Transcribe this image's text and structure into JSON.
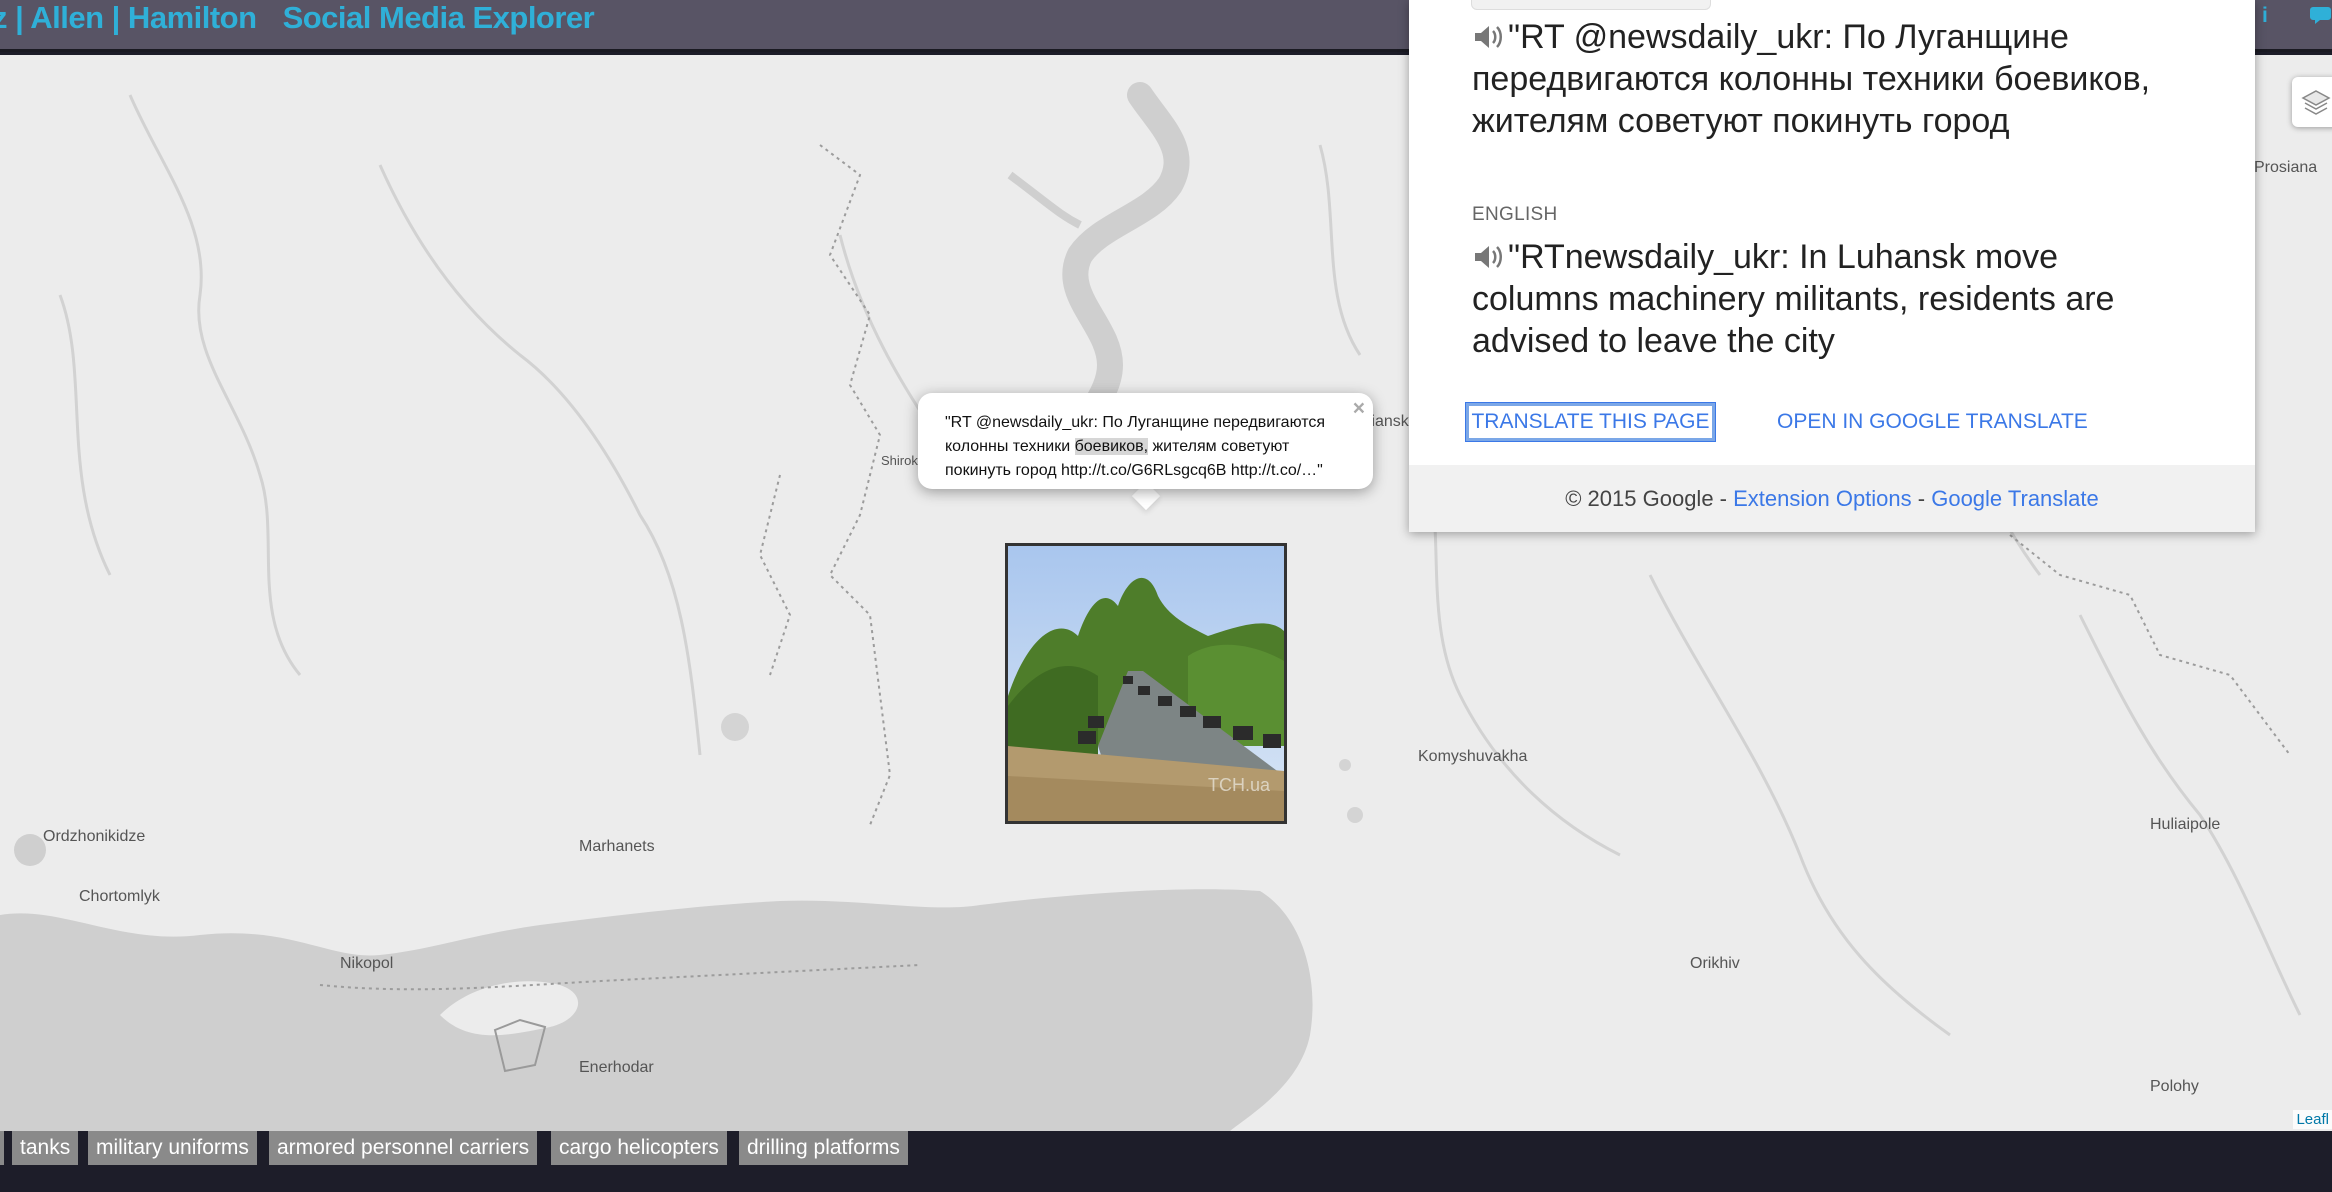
{
  "header": {
    "brand_fragment": "z | Allen | Hamilton",
    "app_title": "Social Media Explorer",
    "info_icon": "info-icon",
    "chat_icon": "chat-icon"
  },
  "map": {
    "places": [
      {
        "id": "prosiana",
        "label": "Prosiana"
      },
      {
        "id": "vilniansk",
        "label": "Vilniansk"
      },
      {
        "id": "shyroke",
        "label": "Shirok"
      },
      {
        "id": "komyshuvakha",
        "label": "Komyshuvakha"
      },
      {
        "id": "ordzhonikidze",
        "label": "Ordzhonikidze"
      },
      {
        "id": "marhanets",
        "label": "Marhanets"
      },
      {
        "id": "chortomlyk",
        "label": "Chortomlyk"
      },
      {
        "id": "huliaipole",
        "label": "Huliaipole"
      },
      {
        "id": "nikopol",
        "label": "Nikopol"
      },
      {
        "id": "orikhiv",
        "label": "Orikhiv"
      },
      {
        "id": "enerhodar",
        "label": "Enerhodar"
      },
      {
        "id": "polohy",
        "label": "Polohy"
      }
    ],
    "attribution": "Leafl",
    "layers_icon": "layers-icon"
  },
  "popup": {
    "text_pre": "\"RT @newsdaily_ukr: По Луганщине передвигаются колонны техники ",
    "text_hl": "боевиков,",
    "text_post": " жителям советуют покинуть город http://t.co/G6RLsgcq6B http://t.co/…\"",
    "close": "×"
  },
  "photo": {
    "watermark": "TCH.ua"
  },
  "translate_panel": {
    "source_text": "\"RT @newsdaily_ukr: По Луганщине передвигаются колонны техники боевиков, жителям советуют покинуть город",
    "target_language": "ENGLISH",
    "translated_text": "\"RTnewsdaily_ukr: In Luhansk move columns machinery militants, residents are advised to leave the city",
    "translate_page_button": "TRANSLATE THIS PAGE",
    "open_gt_button": "OPEN IN GOOGLE TRANSLATE",
    "footer_copyright": "© 2015 Google - ",
    "footer_sep": " - ",
    "footer_link_options": "Extension Options",
    "footer_link_gt": "Google Translate"
  },
  "tags": [
    "tanks",
    "military uniforms",
    "armored personnel carriers",
    "cargo helicopters",
    "drilling platforms"
  ]
}
